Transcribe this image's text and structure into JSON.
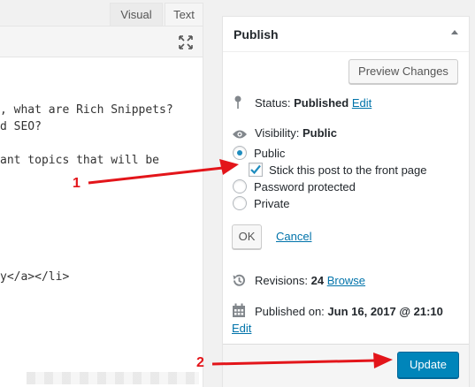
{
  "editor": {
    "tab_visual": "Visual",
    "tab_text": "Text",
    "lines": [
      ", what are Rich Snippets?",
      "d SEO?",
      "ant topics that will be",
      "y</a></li>"
    ]
  },
  "publish": {
    "title": "Publish",
    "preview_button": "Preview Changes",
    "status_label": "Status:",
    "status_value": "Published",
    "status_edit": "Edit",
    "visibility_label": "Visibility:",
    "visibility_value": "Public",
    "option_public": "Public",
    "option_sticky": "Stick this post to the front page",
    "option_password": "Password protected",
    "option_private": "Private",
    "ok_button": "OK",
    "cancel_link": "Cancel",
    "revisions_label": "Revisions:",
    "revisions_count": "24",
    "revisions_browse": "Browse",
    "published_label": "Published on:",
    "published_value": "Jun 16, 2017 @ 21:10",
    "published_edit": "Edit",
    "update_button": "Update"
  },
  "annotations": {
    "marker_1": "1",
    "marker_2": "2"
  },
  "colors": {
    "accent": "#0085ba",
    "link": "#0073aa",
    "annotation": "#e3151a"
  }
}
